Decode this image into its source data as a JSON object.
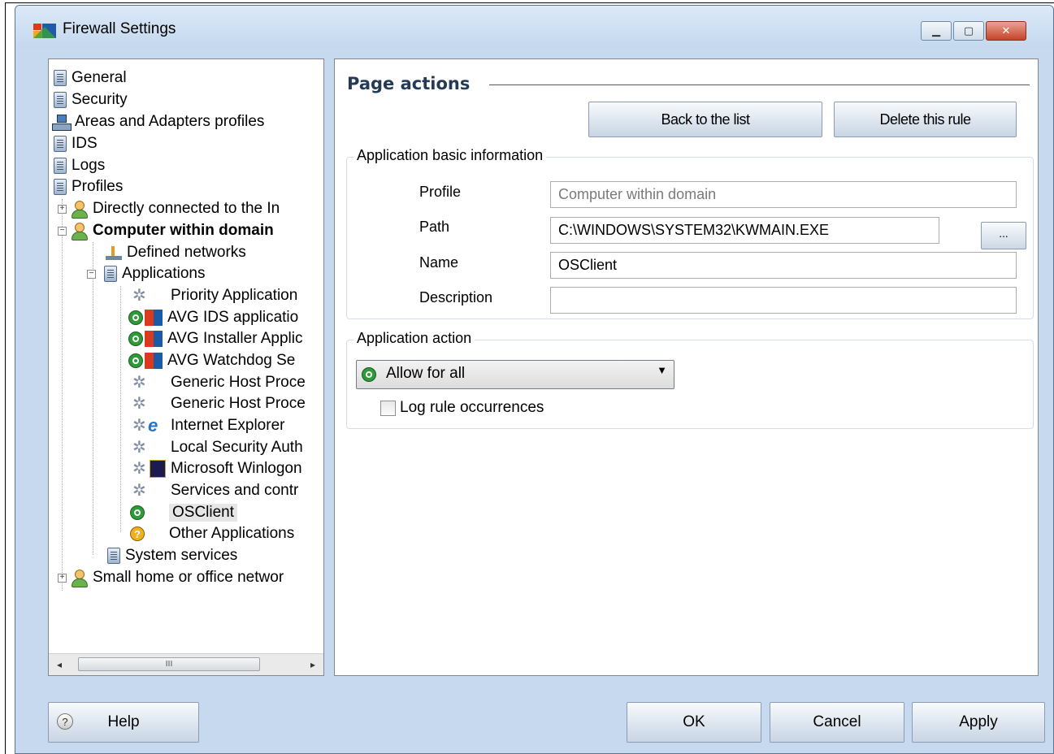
{
  "window": {
    "title": "Firewall Settings"
  },
  "tree": {
    "items": [
      {
        "label": "General",
        "icon": "document-icon"
      },
      {
        "label": "Security",
        "icon": "document-icon"
      },
      {
        "label": "Areas and Adapters profiles",
        "icon": "network-icon"
      },
      {
        "label": "IDS",
        "icon": "document-icon"
      },
      {
        "label": "Logs",
        "icon": "document-icon"
      },
      {
        "label": "Profiles",
        "icon": "document-icon"
      },
      {
        "label": "Directly connected to the In",
        "icon": "user-icon"
      },
      {
        "label": "Computer within domain",
        "icon": "user-icon"
      },
      {
        "label": "Defined networks",
        "icon": "defined-networks-icon"
      },
      {
        "label": "Applications",
        "icon": "document-icon"
      },
      {
        "label": "Priority Application",
        "icon": "gear-icon"
      },
      {
        "label": "AVG IDS applicatio",
        "icon": "avg-icon"
      },
      {
        "label": "AVG Installer Applic",
        "icon": "avg-icon"
      },
      {
        "label": "AVG Watchdog Se",
        "icon": "avg-icon"
      },
      {
        "label": "Generic Host Proce",
        "icon": "gear-icon"
      },
      {
        "label": "Generic Host Proce",
        "icon": "gear-icon"
      },
      {
        "label": "Internet Explorer",
        "icon": "internet-explorer-icon"
      },
      {
        "label": "Local Security Auth",
        "icon": "gear-icon"
      },
      {
        "label": "Microsoft Winlogon",
        "icon": "winlogon-icon"
      },
      {
        "label": "Services and contr",
        "icon": "gear-icon"
      },
      {
        "label": "OSClient",
        "icon": "allow-icon"
      },
      {
        "label": "Other Applications",
        "icon": "question-icon"
      },
      {
        "label": "System services",
        "icon": "document-icon"
      },
      {
        "label": "Small home or office networ",
        "icon": "user-icon"
      }
    ],
    "scroll_thumb": "III"
  },
  "page": {
    "title": "Page actions",
    "back_button": "Back to the list",
    "delete_button": "Delete this rule",
    "basic_info_legend": "Application basic information",
    "profile_label": "Profile",
    "profile_value": "Computer within domain",
    "path_label": "Path",
    "path_value": "C:\\WINDOWS\\SYSTEM32\\KWMAIN.EXE",
    "browse_button": "...",
    "name_label": "Name",
    "name_value": "OSClient",
    "description_label": "Description",
    "description_value": "",
    "action_legend": "Application action",
    "action_value": "Allow for all",
    "log_label": "Log rule occurrences",
    "log_checked": false
  },
  "footer": {
    "help_button": "Help",
    "ok_button": "OK",
    "cancel_button": "Cancel",
    "apply_button": "Apply"
  },
  "colors": {
    "window_bg": "#c6d9ee",
    "title_color": "#243a57",
    "close_button": "#c5442a"
  }
}
